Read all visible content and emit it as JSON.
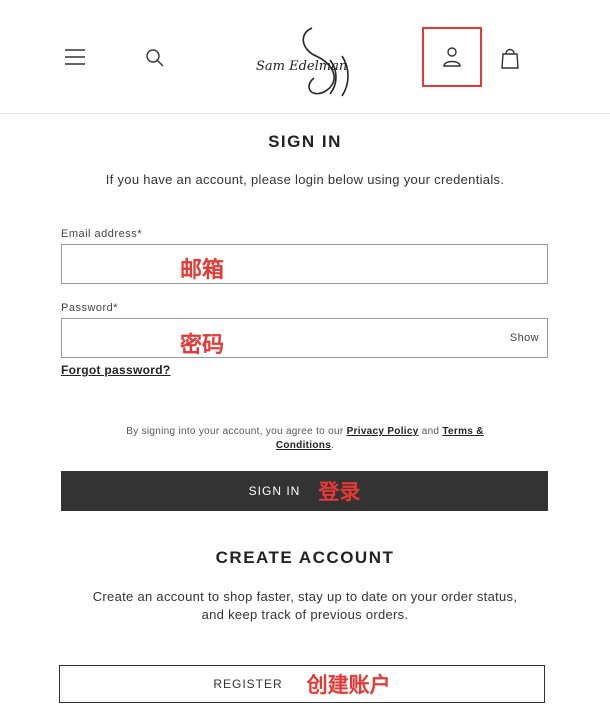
{
  "header": {
    "menu_icon": "hamburger-icon",
    "search_icon": "search-icon",
    "logo_text": "Sam Edelman",
    "account_icon": "user-icon",
    "bag_icon": "shopping-bag-icon",
    "highlight_color": "#e53935"
  },
  "signin": {
    "title": "SIGN IN",
    "intro": "If you have an account, please login below using your credentials.",
    "email_label": "Email address*",
    "email_annotation": "邮箱",
    "password_label": "Password*",
    "password_annotation": "密码",
    "show_label": "Show",
    "forgot_label": "Forgot password?",
    "legal_prefix": "By signing into your account, you agree to our",
    "privacy_label": "Privacy Policy",
    "legal_and": "and",
    "terms_label_1": "Terms &",
    "terms_label_2": "Conditions",
    "legal_suffix": ".",
    "button_label": "SIGN IN",
    "button_annotation": "登录"
  },
  "create": {
    "title": "CREATE ACCOUNT",
    "intro_line1": "Create an account to shop faster, stay up to date on your order status,",
    "intro_line2": "and keep track of previous orders.",
    "button_label": "REGISTER",
    "button_annotation": "创建账户"
  },
  "colors": {
    "annotation": "#e53935",
    "primary_button": "#333333"
  }
}
